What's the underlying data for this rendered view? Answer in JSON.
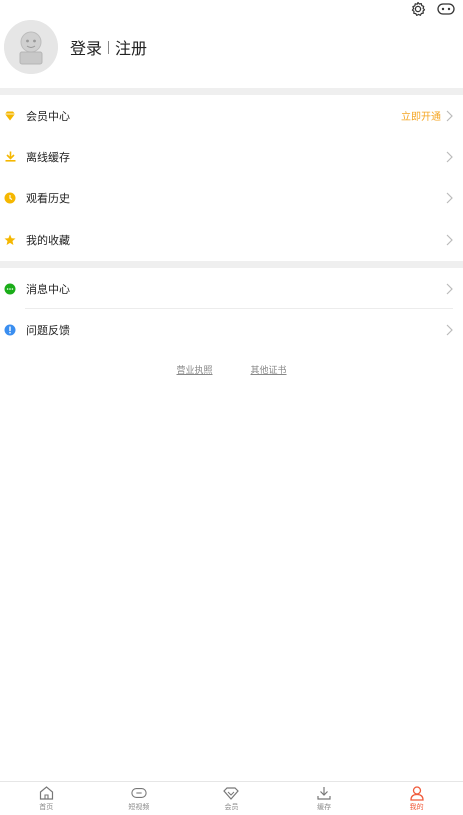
{
  "header": {
    "login_label": "登录",
    "register_label": "注册"
  },
  "menu_group1": [
    {
      "label": "会员中心",
      "extra": "立即开通",
      "icon": "diamond-icon",
      "color": "#f5b700"
    },
    {
      "label": "离线缓存",
      "extra": "",
      "icon": "download-icon",
      "color": "#f5b700"
    },
    {
      "label": "观看历史",
      "extra": "",
      "icon": "clock-icon",
      "color": "#f5b700"
    },
    {
      "label": "我的收藏",
      "extra": "",
      "icon": "star-icon",
      "color": "#f5b700"
    }
  ],
  "menu_group2": [
    {
      "label": "消息中心",
      "icon": "message-icon",
      "color": "#1aad19"
    },
    {
      "label": "问题反馈",
      "icon": "info-icon",
      "color": "#3a8ef0"
    }
  ],
  "links": {
    "license": "营业执照",
    "certificates": "其他证书"
  },
  "tabbar": [
    {
      "label": "首页",
      "icon": "home-icon"
    },
    {
      "label": "短视频",
      "icon": "link-icon"
    },
    {
      "label": "会员",
      "icon": "vip-icon"
    },
    {
      "label": "缓存",
      "icon": "download-icon"
    },
    {
      "label": "我的",
      "icon": "user-icon",
      "active": true
    }
  ],
  "colors": {
    "accent": "#f05a3a",
    "vip_link": "#f5a623"
  }
}
